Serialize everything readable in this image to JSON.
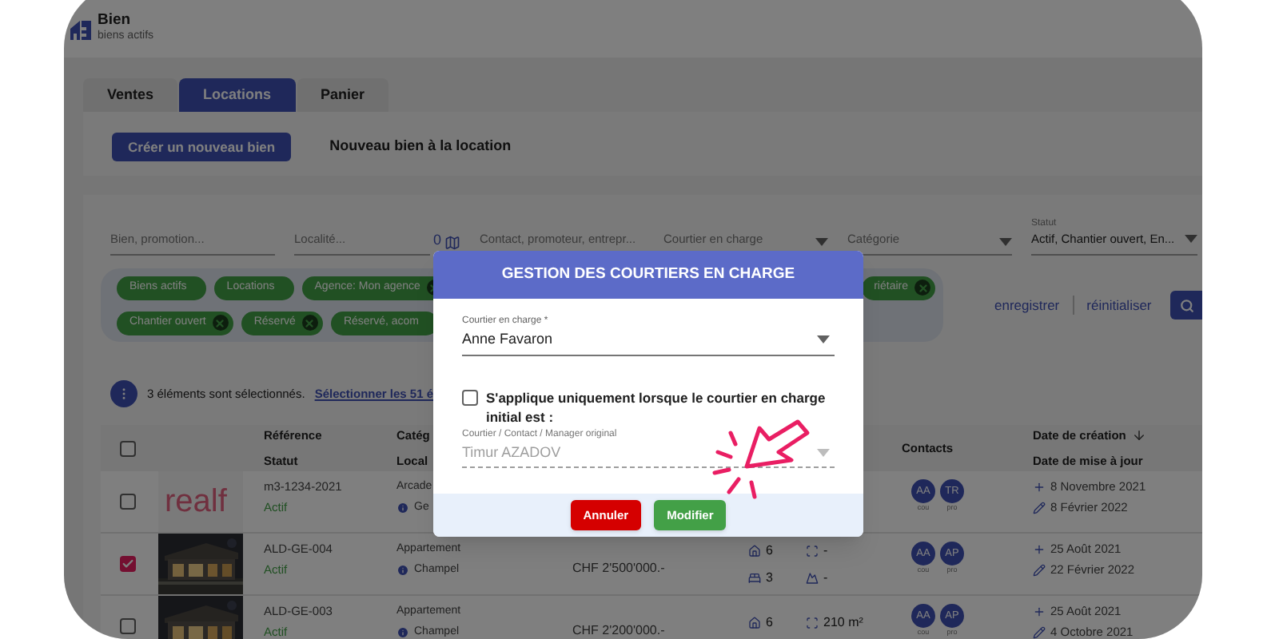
{
  "header": {
    "title": "Bien",
    "subtitle": "biens actifs"
  },
  "tabs": [
    {
      "label": "Ventes",
      "selected": false
    },
    {
      "label": "Locations",
      "selected": true
    },
    {
      "label": "Panier",
      "selected": false
    }
  ],
  "create_button": "Créer un nouveau bien",
  "create_caption": "Nouveau bien à la location",
  "filters": [
    {
      "kind": "text",
      "placeholder": "Bien, promotion..."
    },
    {
      "kind": "map",
      "placeholder": "Localité...",
      "count": "0"
    },
    {
      "kind": "text",
      "placeholder": "Contact, promoteur, entrepr..."
    },
    {
      "kind": "select",
      "placeholder": "Courtier en charge"
    },
    {
      "kind": "select",
      "placeholder": "Catégorie"
    },
    {
      "kind": "labeled",
      "label": "Statut",
      "value": "Actif, Chantier ouvert, En..."
    }
  ],
  "chips_left": [
    [
      {
        "label": "Biens actifs",
        "removable": false
      },
      {
        "label": "Locations",
        "removable": false
      },
      {
        "label": "Agence: Mon agence",
        "removable": true
      }
    ],
    [
      {
        "label": "Chantier ouvert",
        "removable": true
      },
      {
        "label": "Réservé",
        "removable": true
      },
      {
        "label": "Réservé, acom",
        "removable": false
      }
    ]
  ],
  "chips_right": [
    {
      "label": "riétaire",
      "removable": true
    }
  ],
  "filter_actions": [
    "enregistrer",
    "réinitialiser"
  ],
  "selection": {
    "text": "3 éléments sont sélectionnés.",
    "link": "Sélectionner les 51 é"
  },
  "table": {
    "select_all": false,
    "columns": [
      {
        "kind": "ref",
        "lines": [
          "Référence",
          "Statut"
        ]
      },
      {
        "kind": "cat",
        "lines": [
          "Catég",
          "Local"
        ]
      },
      {
        "kind": "contacts",
        "lines": [
          "Contacts"
        ]
      },
      {
        "kind": "dates",
        "lines": [
          "Date de création",
          "Date de mise à jour"
        ],
        "sorted": true
      }
    ],
    "rows": [
      {
        "checked": false,
        "image": {
          "kind": "logo",
          "text": "realf"
        },
        "ref": "m3-1234-2021",
        "status": "Actif",
        "category": "Arcade",
        "locality": "Ge",
        "contacts": [
          {
            "initials": "AA",
            "role": "cou"
          },
          {
            "initials": "TR",
            "role": "pro"
          }
        ],
        "created": "8 Novembre 2021",
        "updated": "8 Février 2022"
      },
      {
        "checked": true,
        "image": {
          "kind": "picture"
        },
        "ref": "ALD-GE-004",
        "status": "Actif",
        "category": "Appartement",
        "locality": "Champel",
        "price": "CHF 2'500'000.-",
        "rooms": "6",
        "surface": "-",
        "bedrooms": "3",
        "land": "-",
        "contacts": [
          {
            "initials": "AA",
            "role": "cou"
          },
          {
            "initials": "AP",
            "role": "pro"
          }
        ],
        "created": "25 Août 2021",
        "updated": "22 Février 2022"
      },
      {
        "checked": false,
        "image": {
          "kind": "picture"
        },
        "ref": "ALD-GE-003",
        "status": "Actif",
        "category": "Appartement",
        "locality": "Champel",
        "price": "CHF 2'200'000.-",
        "rooms": "6",
        "surface": "210 m²",
        "contacts": [
          {
            "initials": "AA",
            "role": "cou"
          },
          {
            "initials": "AP",
            "role": "pro"
          }
        ],
        "created": "25 Août 2021",
        "updated": "4 Octobre 2021"
      }
    ]
  },
  "modal": {
    "title": "GESTION DES COURTIERS EN CHARGE",
    "broker_field": {
      "label": "Courtier en charge *",
      "value": "Anne Favaron"
    },
    "condition": {
      "label": "S'applique uniquement lorsque le courtier en charge initial est :",
      "checked": false
    },
    "original_field": {
      "label": "Courtier / Contact / Manager original",
      "value": "Timur AZADOV",
      "disabled": true
    },
    "buttons": [
      {
        "label": "Annuler",
        "kind": "cancel"
      },
      {
        "label": "Modifier",
        "kind": "confirm"
      }
    ]
  }
}
